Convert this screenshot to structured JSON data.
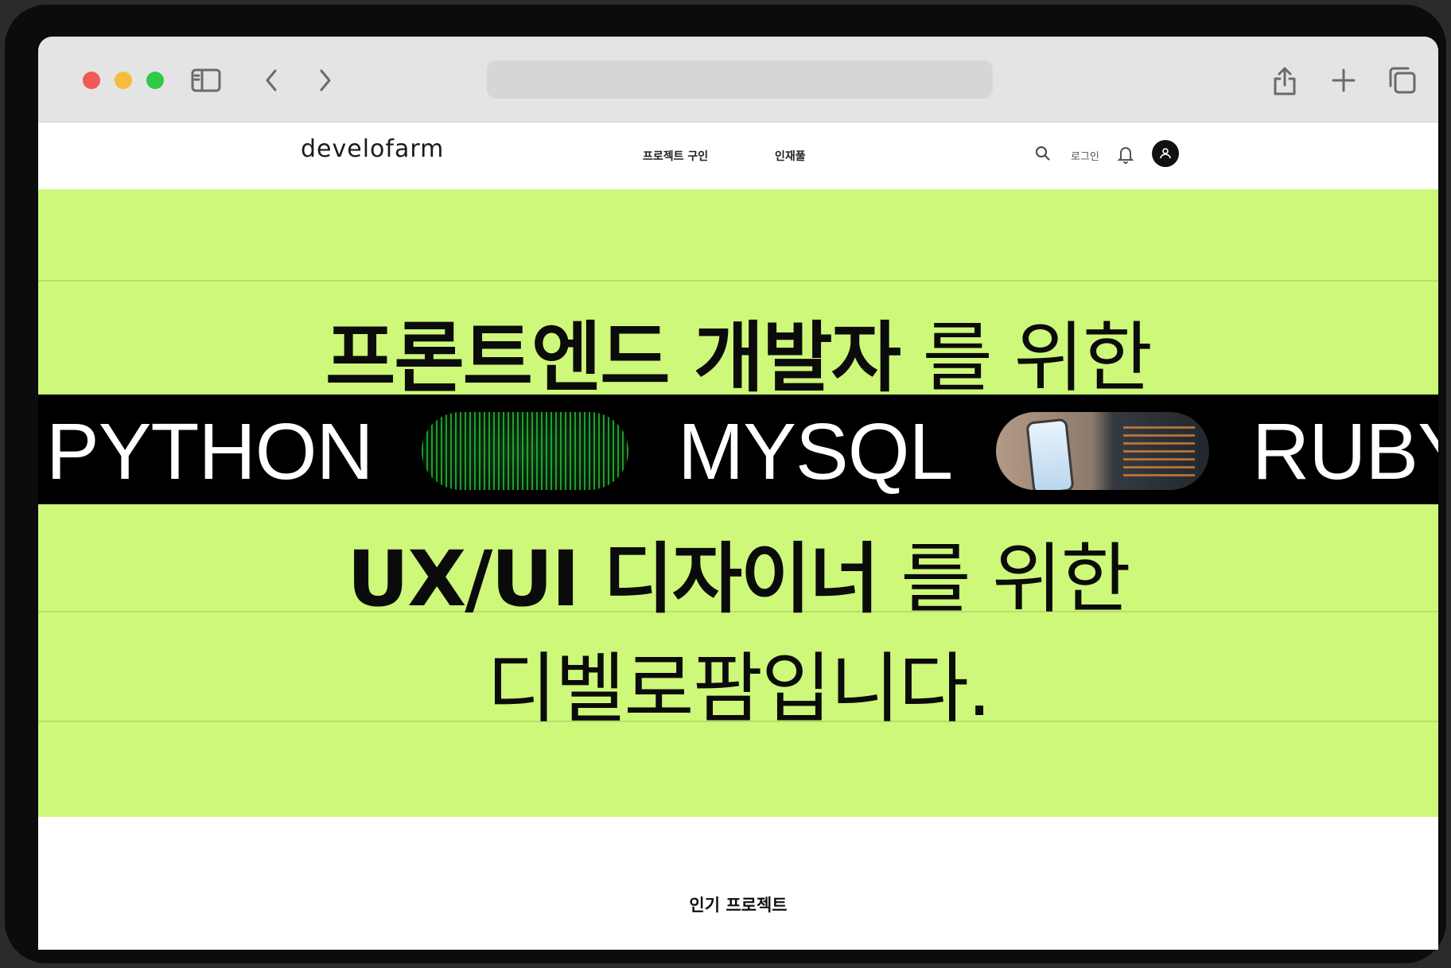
{
  "site": {
    "logo": "develofarm",
    "nav": [
      "프로젝트 구인",
      "인재풀"
    ],
    "login": "로그인"
  },
  "hero": {
    "line1_bold": "프론트엔드 개발자",
    "line1_rest": "를 위한",
    "line2_bold": "UX/UI 디자이너",
    "line2_rest": "를 위한",
    "line3": "디벨로팜입니다.",
    "marquee": [
      "PYTHON",
      "MYSQL",
      "RUBY"
    ]
  },
  "section": {
    "title": "인기 프로젝트"
  },
  "colors": {
    "hero_bg": "#cdf87a",
    "marquee_bg": "#000000",
    "toolbar_bg": "#e4e4e4"
  },
  "icons": [
    "sidebar-icon",
    "back-icon",
    "forward-icon",
    "share-icon",
    "new-tab-icon",
    "tabs-icon",
    "search-icon",
    "bell-icon",
    "user-icon"
  ]
}
